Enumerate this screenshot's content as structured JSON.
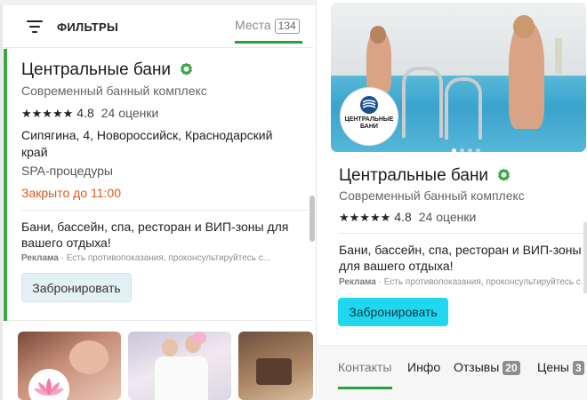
{
  "filters": {
    "label": "ФИЛЬТРЫ",
    "places_label": "Места",
    "places_count": "134"
  },
  "left_card": {
    "title": "Центральные бани",
    "subtitle": "Современный банный комплекс",
    "stars": "★★★★★",
    "rating": "4.8",
    "rating_count": "24 оценки",
    "address": "Сипягина, 4, Новороссийск, Краснодарский край",
    "category": "SPA-процедуры",
    "hours": "Закрыто до 11:00",
    "ad_text": "Бани, бассейн, спа, ресторан и ВИП-зоны для вашего отдыха!",
    "ad_label": "Реклама",
    "ad_disclaimer": " · Есть противопоказания, проконсультируйтесь с...",
    "book_label": "Забронировать"
  },
  "right_card": {
    "logo_text": "ЦЕНТРАЛЬНЫЕ БАНИ",
    "title": "Центральные бани",
    "subtitle": "Современный банный комплекс",
    "stars": "★★★★★",
    "rating": "4.8",
    "rating_count": "24 оценки",
    "ad_text": "Бани, бассейн, спа, ресторан и ВИП-зоны для вашего отдыха!",
    "ad_label": "Реклама",
    "ad_disclaimer": " · Есть противопоказания, проконсультируйтесь с...",
    "book_label": "Забронировать"
  },
  "tabs": [
    {
      "label": "Контакты",
      "count": null,
      "active": true
    },
    {
      "label": "Инфо",
      "count": null,
      "active": false
    },
    {
      "label": "Отзывы",
      "count": "20",
      "active": false
    },
    {
      "label": "Цены",
      "count": "3",
      "active": false
    }
  ],
  "colors": {
    "accent_green": "#2aa13a",
    "book_button_cyan": "#1fd8f0",
    "closed_orange": "#e0581e"
  }
}
